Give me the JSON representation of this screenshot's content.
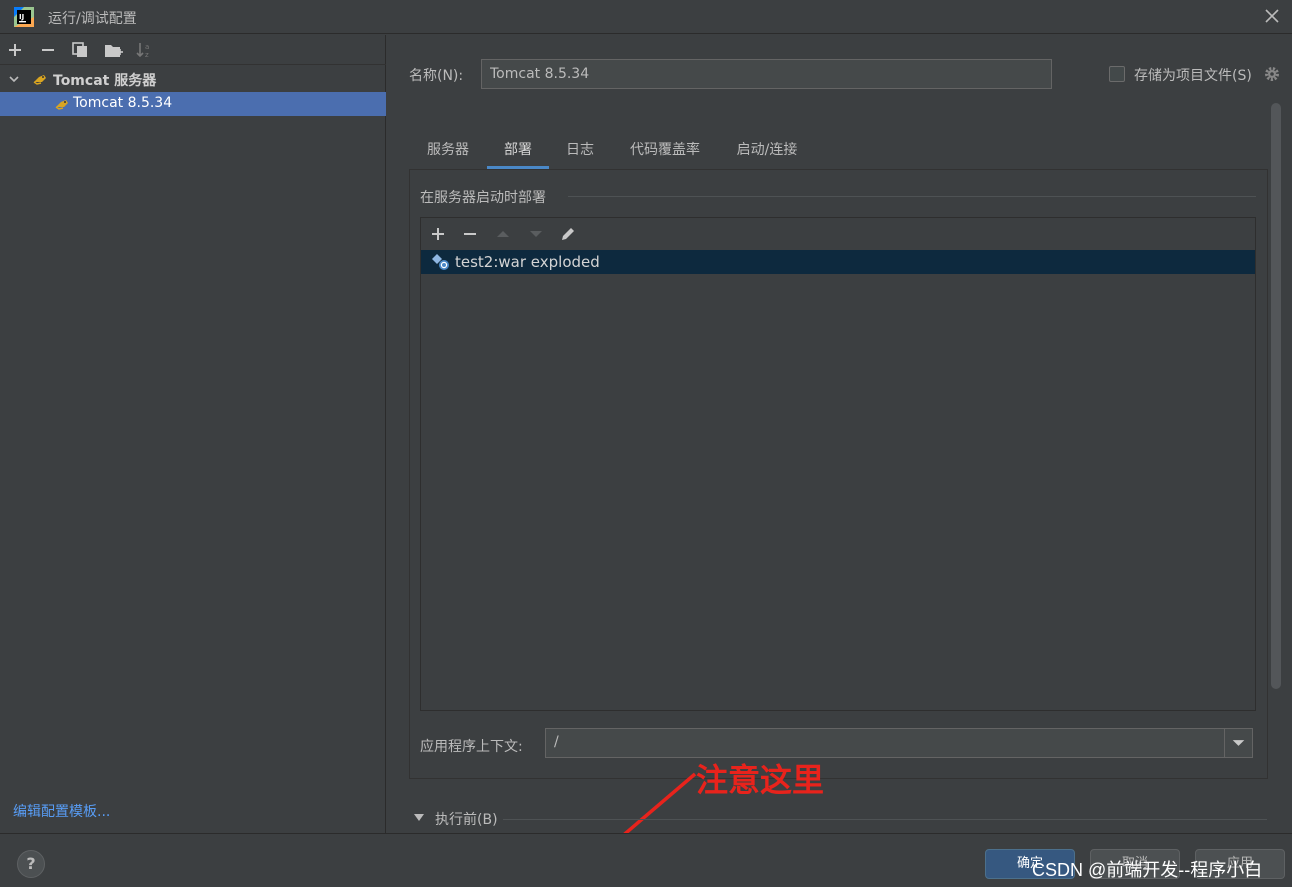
{
  "window": {
    "title": "运行/调试配置"
  },
  "left_panel": {
    "toolbar": [
      "add",
      "remove",
      "copy",
      "new-folder",
      "sort"
    ],
    "tree": {
      "group_label": "Tomcat 服务器",
      "items": [
        {
          "label": "Tomcat 8.5.34",
          "selected": true
        }
      ]
    },
    "edit_templates_link": "编辑配置模板..."
  },
  "right_panel": {
    "name_label": "名称(N):",
    "name_value": "Tomcat 8.5.34",
    "store_as_project_file_label": "存储为项目文件(S)",
    "store_as_project_file_checked": false,
    "tabs": [
      {
        "label": "服务器",
        "active": false
      },
      {
        "label": "部署",
        "active": true
      },
      {
        "label": "日志",
        "active": false
      },
      {
        "label": "代码覆盖率",
        "active": false
      },
      {
        "label": "启动/连接",
        "active": false
      }
    ],
    "deploy_section_title": "在服务器启动时部署",
    "deploy_toolbar": [
      "add",
      "remove",
      "move-up",
      "move-down",
      "edit"
    ],
    "artifacts": [
      {
        "label": "test2:war exploded",
        "selected": true
      }
    ],
    "app_context_label": "应用程序上下文:",
    "app_context_value": "/",
    "before_launch_label": "执行前(B)"
  },
  "annotation": {
    "text": "注意这里",
    "color": "#e8231c"
  },
  "bottom_bar": {
    "help_label": "?",
    "ok_label": "确定",
    "cancel_label": "取消",
    "apply_label": "应用"
  },
  "watermark": "CSDN @前端开发--程序小白",
  "colors": {
    "background": "#3c3f41",
    "selection": "#4b6eaf",
    "active_tab_underline": "#4a88c7",
    "link": "#589df6",
    "primary_button": "#365880"
  }
}
